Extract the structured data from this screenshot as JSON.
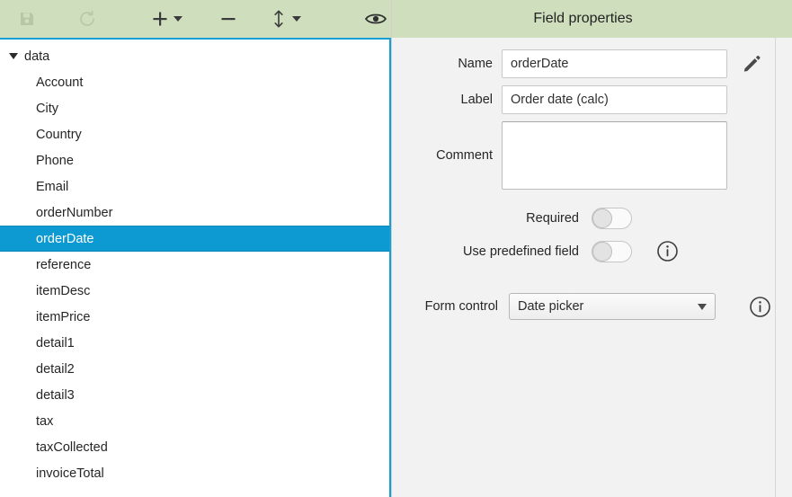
{
  "toolbar": {
    "buttons": [
      {
        "name": "save-button",
        "icon": "save-icon",
        "enabled": false,
        "has_dropdown": false
      },
      {
        "name": "refresh-button",
        "icon": "refresh-icon",
        "enabled": false,
        "has_dropdown": false
      },
      {
        "name": "add-button",
        "icon": "plus-icon",
        "enabled": true,
        "has_dropdown": true
      },
      {
        "name": "remove-button",
        "icon": "minus-icon",
        "enabled": true,
        "has_dropdown": false
      },
      {
        "name": "move-button",
        "icon": "up-down-arrow-icon",
        "enabled": true,
        "has_dropdown": true
      },
      {
        "name": "preview-button",
        "icon": "eye-icon",
        "enabled": true,
        "has_dropdown": false
      }
    ],
    "background_color": "#cfdfbd"
  },
  "tree": {
    "root": {
      "label": "data",
      "expanded": true
    },
    "items": [
      {
        "label": "Account",
        "selected": false
      },
      {
        "label": "City",
        "selected": false
      },
      {
        "label": "Country",
        "selected": false
      },
      {
        "label": "Phone",
        "selected": false
      },
      {
        "label": "Email",
        "selected": false
      },
      {
        "label": "orderNumber",
        "selected": false
      },
      {
        "label": "orderDate",
        "selected": true
      },
      {
        "label": "reference",
        "selected": false
      },
      {
        "label": "itemDesc",
        "selected": false
      },
      {
        "label": "itemPrice",
        "selected": false
      },
      {
        "label": "detail1",
        "selected": false
      },
      {
        "label": "detail2",
        "selected": false
      },
      {
        "label": "detail3",
        "selected": false
      },
      {
        "label": "tax",
        "selected": false
      },
      {
        "label": "taxCollected",
        "selected": false
      },
      {
        "label": "invoiceTotal",
        "selected": false
      }
    ],
    "selection_color": "#0d9ad2",
    "border_color": "#14a0d7"
  },
  "properties": {
    "title": "Field properties",
    "name": {
      "label": "Name",
      "value": "orderDate",
      "placeholder": ""
    },
    "field_label": {
      "label": "Label",
      "value": "Order date (calc)",
      "placeholder": ""
    },
    "comment": {
      "label": "Comment",
      "value": "",
      "placeholder": ""
    },
    "required": {
      "label": "Required",
      "state": "off"
    },
    "use_predefined_field": {
      "label": "Use predefined field",
      "state": "off"
    },
    "form_control": {
      "label": "Form control",
      "value": "Date picker",
      "options": [
        "Date picker"
      ]
    },
    "edit_icon": "pencil-icon",
    "info_icon": "info-circle-icon"
  }
}
